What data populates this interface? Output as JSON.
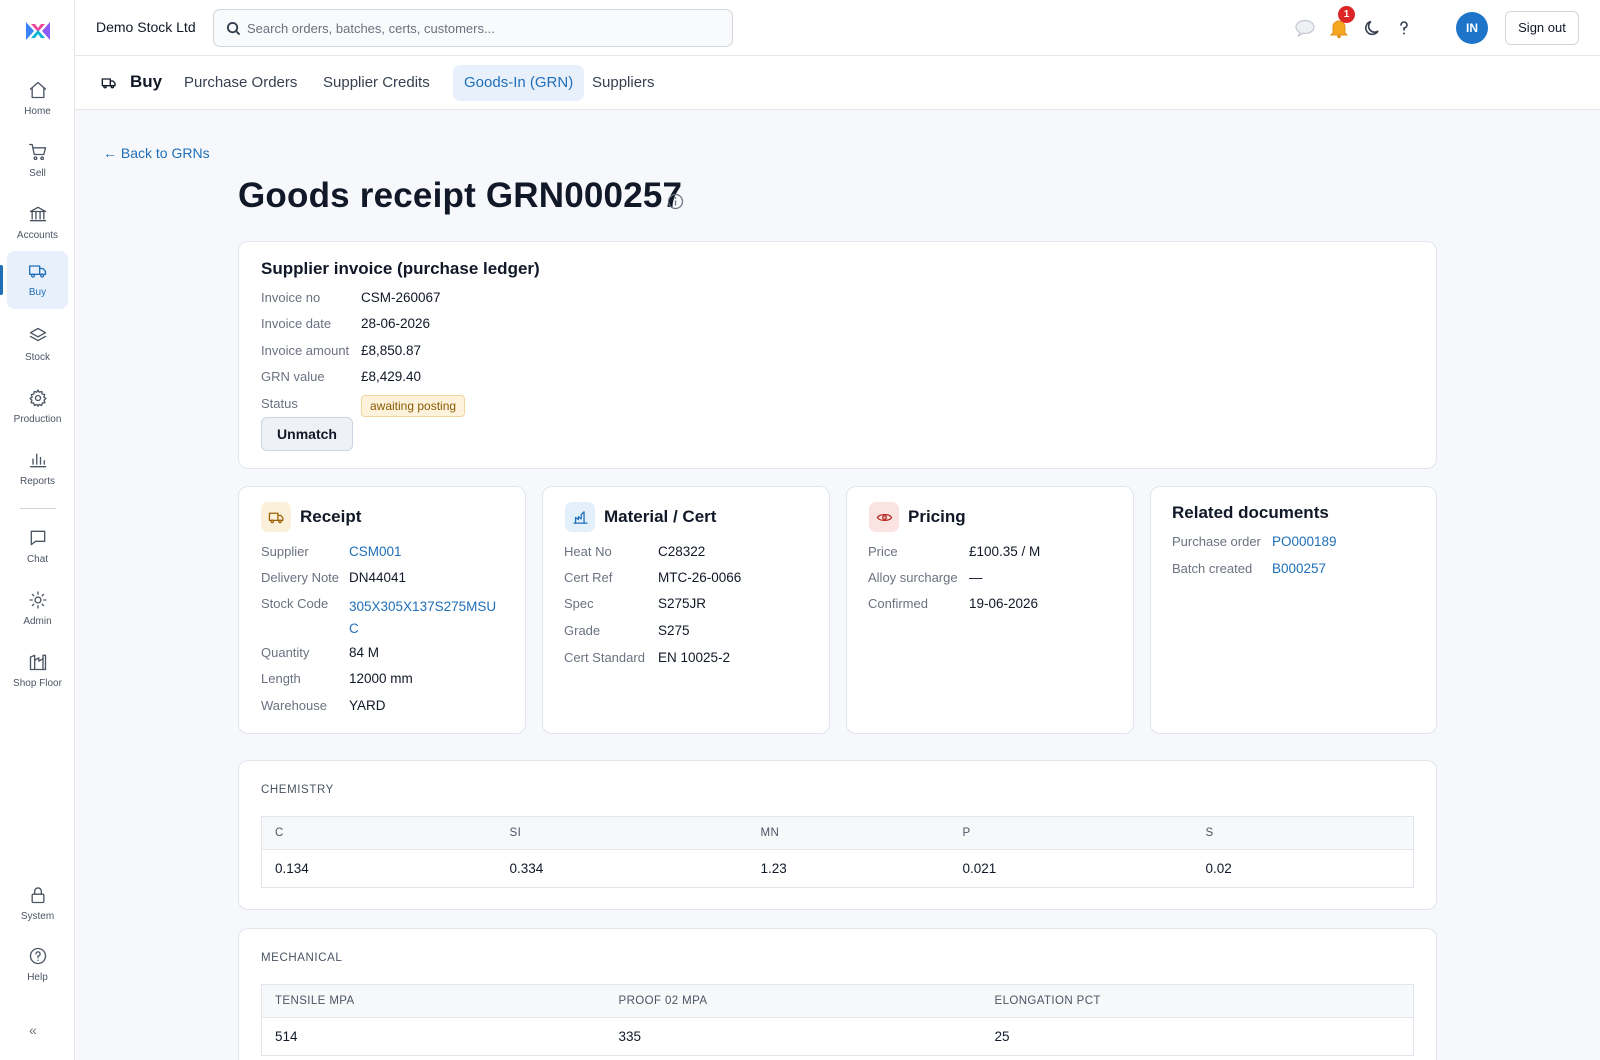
{
  "app": {
    "company": "Demo Stock Ltd",
    "search_placeholder": "Search orders, batches, certs, customers...",
    "notification_count": "1",
    "avatar_initials": "IN",
    "sign_out_label": "Sign out"
  },
  "sidebar": {
    "items": [
      {
        "label": "Home",
        "icon": "home-icon"
      },
      {
        "label": "Sell",
        "icon": "cart-icon"
      },
      {
        "label": "Accounts",
        "icon": "bank-icon"
      },
      {
        "label": "Buy",
        "icon": "truck-icon",
        "active": true
      },
      {
        "label": "Stock",
        "icon": "layers-icon"
      },
      {
        "label": "Production",
        "icon": "gear-icon"
      },
      {
        "label": "Reports",
        "icon": "bar-chart-icon"
      },
      {
        "label": "Chat",
        "icon": "chat-icon"
      },
      {
        "label": "Admin",
        "icon": "sun-icon"
      },
      {
        "label": "Shop Floor",
        "icon": "factory-icon"
      },
      {
        "label": "System",
        "icon": "lock-icon"
      },
      {
        "label": "Help",
        "icon": "help-icon"
      }
    ],
    "collapse_label": "«"
  },
  "subnav": {
    "section": "Buy",
    "tabs": [
      {
        "label": "Purchase Orders"
      },
      {
        "label": "Supplier Credits"
      },
      {
        "label": "Goods-In (GRN)",
        "active": true
      },
      {
        "label": "Suppliers"
      }
    ]
  },
  "page": {
    "back_link": "← Back to GRNs",
    "title": "Goods receipt GRN000257"
  },
  "invoice": {
    "heading": "Supplier invoice (purchase ledger)",
    "rows": [
      {
        "label": "Invoice no",
        "value": "CSM-260067"
      },
      {
        "label": "Invoice date",
        "value": "28-06-2026"
      },
      {
        "label": "Invoice amount",
        "value": "£8,850.87"
      },
      {
        "label": "GRN value",
        "value": "£8,429.40"
      }
    ],
    "status_label": "Status",
    "status_value": "awaiting posting",
    "unmatch_label": "Unmatch"
  },
  "receipt": {
    "heading": "Receipt",
    "supplier_label": "Supplier",
    "supplier": "CSM001",
    "delivery_label": "Delivery Note",
    "delivery": "DN44041",
    "stock_code_label": "Stock Code",
    "stock_code": "305X305X137S275MSUC",
    "quantity_label": "Quantity",
    "quantity": "84 M",
    "length_label": "Length",
    "length": "12000 mm",
    "warehouse_label": "Warehouse",
    "warehouse": "YARD"
  },
  "material": {
    "heading": "Material / Cert",
    "rows": [
      {
        "label": "Heat No",
        "value": "C28322"
      },
      {
        "label": "Cert Ref",
        "value": "MTC-26-0066"
      },
      {
        "label": "Spec",
        "value": "S275JR"
      },
      {
        "label": "Grade",
        "value": "S275"
      },
      {
        "label": "Cert Standard",
        "value": "EN 10025-2"
      }
    ]
  },
  "pricing": {
    "heading": "Pricing",
    "rows": [
      {
        "label": "Price",
        "value": "£100.35 / M"
      },
      {
        "label": "Alloy surcharge",
        "value": "—"
      },
      {
        "label": "Confirmed",
        "value": "19-06-2026"
      }
    ]
  },
  "related": {
    "heading": "Related documents",
    "po_label": "Purchase order",
    "po": "PO000189",
    "batch_label": "Batch created",
    "batch": "B000257"
  },
  "chemistry": {
    "label": "CHEMISTRY",
    "headers": [
      "C",
      "SI",
      "MN",
      "P",
      "S"
    ],
    "values": [
      "0.134",
      "0.334",
      "1.23",
      "0.021",
      "0.02"
    ]
  },
  "mechanical": {
    "label": "MECHANICAL",
    "headers": [
      "TENSILE MPA",
      "PROOF 02 MPA",
      "ELONGATION PCT"
    ],
    "values": [
      "514",
      "335",
      "25"
    ]
  }
}
